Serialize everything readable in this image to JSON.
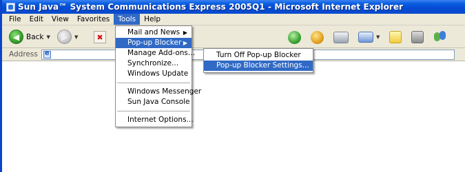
{
  "window": {
    "title": "Sun Java™ System Communications Express 2005Q1 - Microsoft Internet Explorer"
  },
  "menubar": {
    "items": [
      "File",
      "Edit",
      "View",
      "Favorites",
      "Tools",
      "Help"
    ],
    "active": "Tools"
  },
  "toolbar": {
    "back_label": "Back",
    "icons": [
      "back-icon",
      "forward-icon",
      "stop-icon",
      "history-icon",
      "mail-icon",
      "print-icon",
      "edit-icon",
      "note-icon",
      "research-icon",
      "messenger-icon"
    ]
  },
  "addressbar": {
    "label": "Address"
  },
  "tools_menu": {
    "items": [
      {
        "label": "Mail and News",
        "has_submenu": true
      },
      {
        "label": "Pop-up Blocker",
        "has_submenu": true,
        "highlighted": true
      },
      {
        "label": "Manage Add-ons..."
      },
      {
        "label": "Synchronize..."
      },
      {
        "label": "Windows Update"
      },
      {
        "label": "Windows Messenger"
      },
      {
        "label": "Sun Java Console"
      },
      {
        "label": "Internet Options..."
      }
    ]
  },
  "popup_submenu": {
    "items": [
      {
        "label": "Turn Off Pop-up Blocker"
      },
      {
        "label": "Pop-up Blocker Settings...",
        "highlighted": true
      }
    ]
  },
  "colors": {
    "title_bar": "#0449d3",
    "highlight": "#316ac5",
    "chrome": "#ece9d8"
  }
}
